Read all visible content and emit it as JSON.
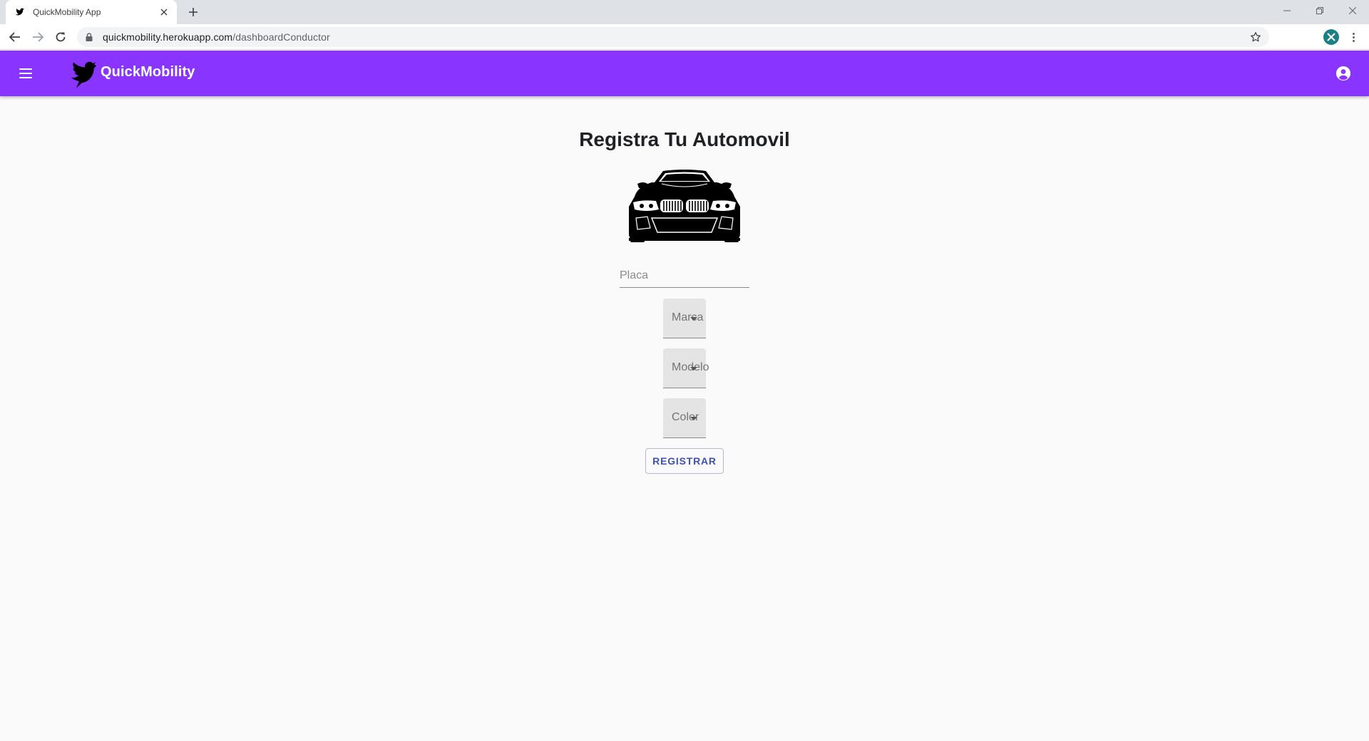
{
  "browser": {
    "tab_title": "QuickMobility App",
    "tab_close_icon": "close-icon",
    "new_tab_label": "+",
    "url_host": "quickmobility.herokuapp.com",
    "url_path": "/dashboardConductor"
  },
  "appbar": {
    "brand_name": "QuickMobility",
    "color": "#8a34ff",
    "menu_icon": "hamburger-menu-icon",
    "account_icon": "account-circle-icon"
  },
  "form": {
    "title": "Registra Tu Automovil",
    "car_image": "car-front-image",
    "placa": {
      "placeholder": "Placa",
      "value": ""
    },
    "marca_label": "Marca",
    "modelo_label": "Modelo",
    "color_label": "Color",
    "register_label": "REGISTRAR",
    "accent": "#3f51b5"
  }
}
